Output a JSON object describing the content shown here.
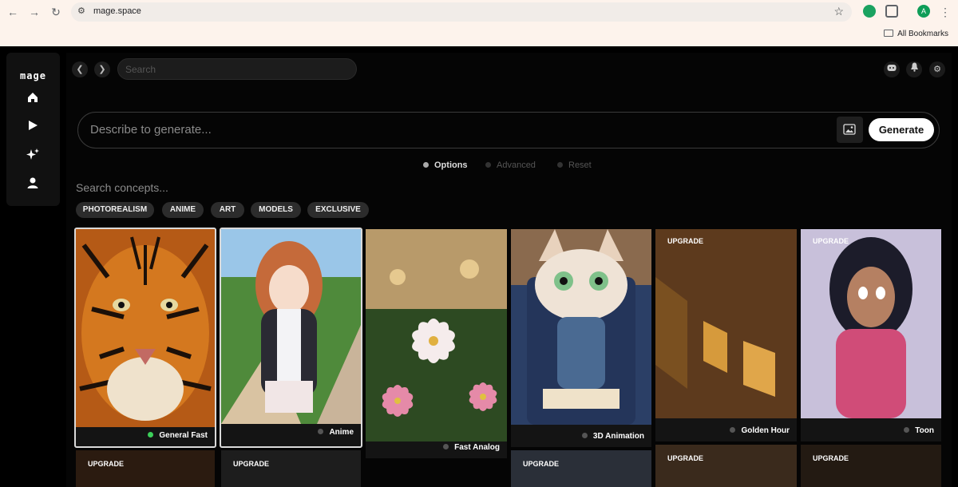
{
  "browser": {
    "url": "mage.space",
    "bookmarks_label": "All Bookmarks",
    "profile_initial": "A"
  },
  "sidebar": {
    "logo": "mage",
    "items": [
      {
        "icon": "home-icon"
      },
      {
        "icon": "play-icon"
      },
      {
        "icon": "sparkles-icon"
      },
      {
        "icon": "user-icon"
      }
    ]
  },
  "topbar": {
    "search_placeholder": "Search"
  },
  "prompt": {
    "placeholder": "Describe to generate...",
    "generate_label": "Generate"
  },
  "options": [
    {
      "label": "Options",
      "active": true
    },
    {
      "label": "Advanced",
      "active": false
    },
    {
      "label": "Reset",
      "active": false
    }
  ],
  "concepts": {
    "search_placeholder": "Search concepts...",
    "chips": [
      "PHOTOREALISM",
      "ANIME",
      "ART",
      "MODELS",
      "EXCLUSIVE"
    ]
  },
  "cards": [
    {
      "label": "General Fast",
      "selected": true,
      "status": "active",
      "upgrade": false
    },
    {
      "label": "Anime",
      "selected": true,
      "status": "inactive",
      "upgrade": false
    },
    {
      "label": "Fast Analog",
      "selected": false,
      "status": "inactive",
      "upgrade": false
    },
    {
      "label": "3D Animation",
      "selected": false,
      "status": "inactive",
      "upgrade": false
    },
    {
      "label": "Golden Hour",
      "selected": false,
      "status": "inactive",
      "upgrade": true
    },
    {
      "label": "Toon",
      "selected": false,
      "status": "inactive",
      "upgrade": true
    }
  ],
  "next_row_badges": [
    "UPGRADE",
    "UPGRADE",
    "UPGRADE",
    "UPGRADE",
    "UPGRADE"
  ],
  "colors": {
    "accent_active": "#3ccf5a",
    "background": "#000000"
  }
}
